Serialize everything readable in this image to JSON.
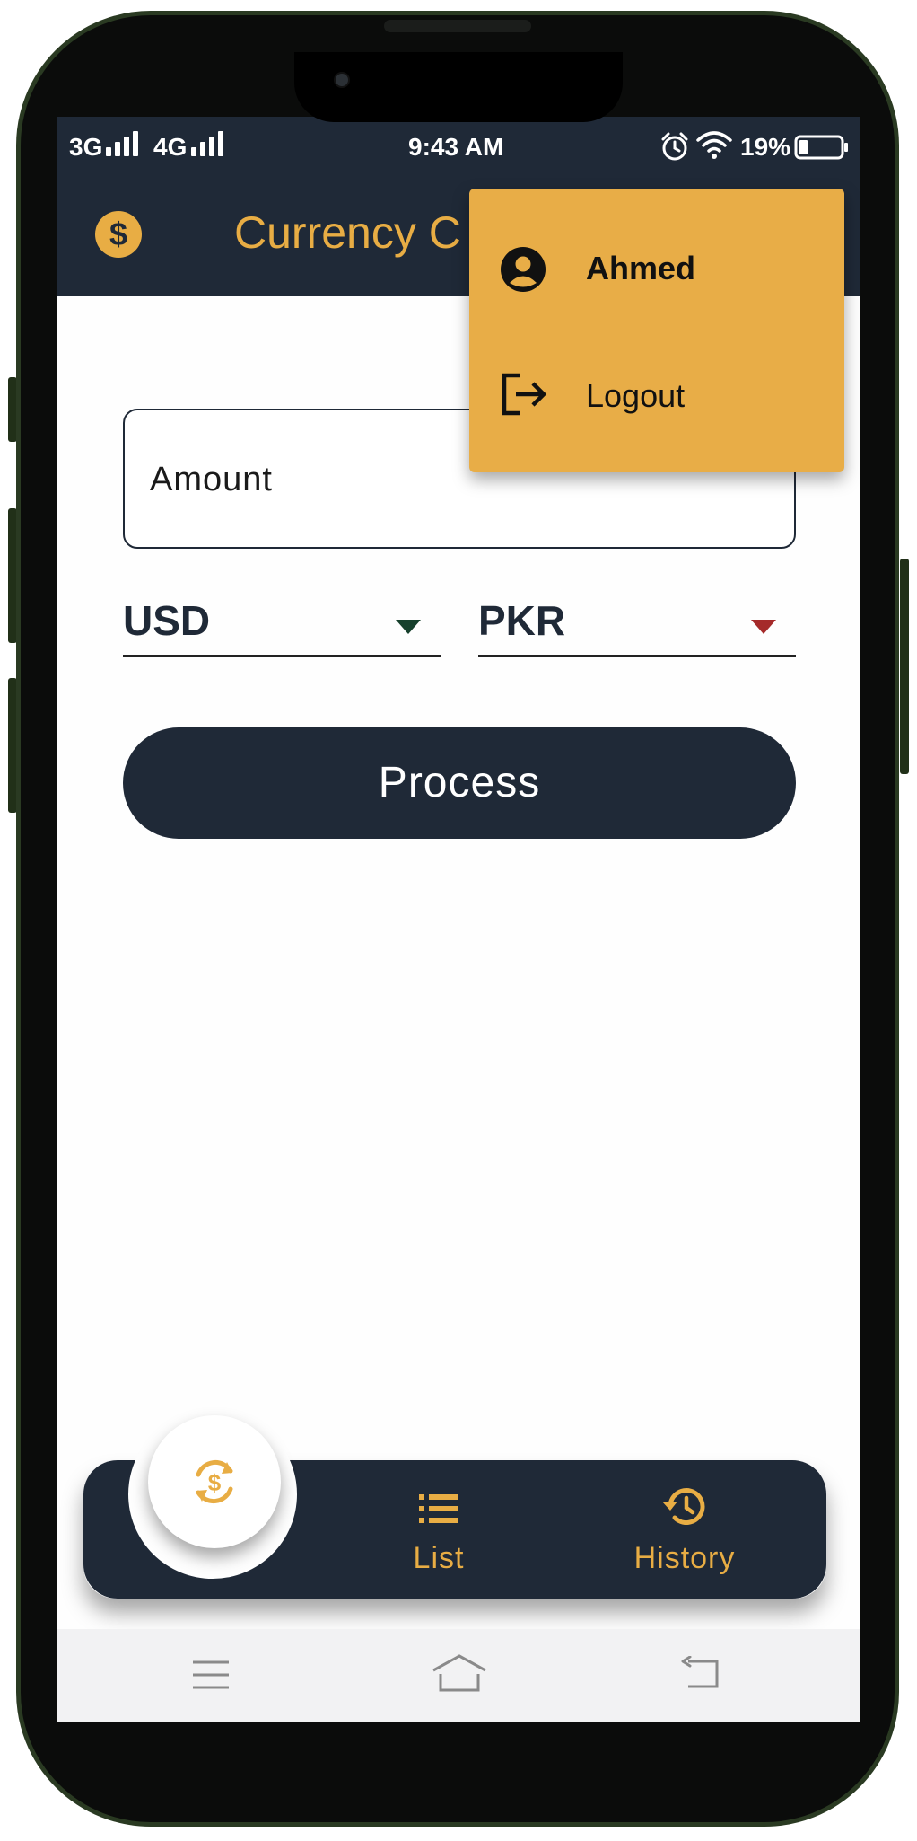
{
  "status_bar": {
    "network_1": "3G",
    "network_2": "4G",
    "time": "9:43 AM",
    "battery": "19%",
    "icons": [
      "signal-icon",
      "alarm-icon",
      "wifi-icon",
      "battery-icon"
    ]
  },
  "app_bar": {
    "title": "Currency C",
    "icon": "dollar-coin-icon"
  },
  "popup_menu": {
    "items": [
      {
        "label": "Ahmed",
        "icon": "account-circle-icon"
      },
      {
        "label": "Logout",
        "icon": "logout-icon"
      }
    ]
  },
  "form": {
    "amount_placeholder": "Amount",
    "amount_value": "",
    "from_currency": "USD",
    "to_currency": "PKR",
    "process_label": "Process"
  },
  "bottom_nav": {
    "items": [
      {
        "label": "",
        "icon": "currency-exchange-icon",
        "active": true
      },
      {
        "label": "List",
        "icon": "list-icon"
      },
      {
        "label": "History",
        "icon": "history-icon"
      }
    ]
  },
  "system_nav": [
    "menu-icon",
    "home-icon",
    "back-icon"
  ],
  "colors": {
    "primary": "#1f2937",
    "accent": "#e8ad44",
    "from_caret": "#16402c",
    "to_caret": "#a52a2a"
  }
}
